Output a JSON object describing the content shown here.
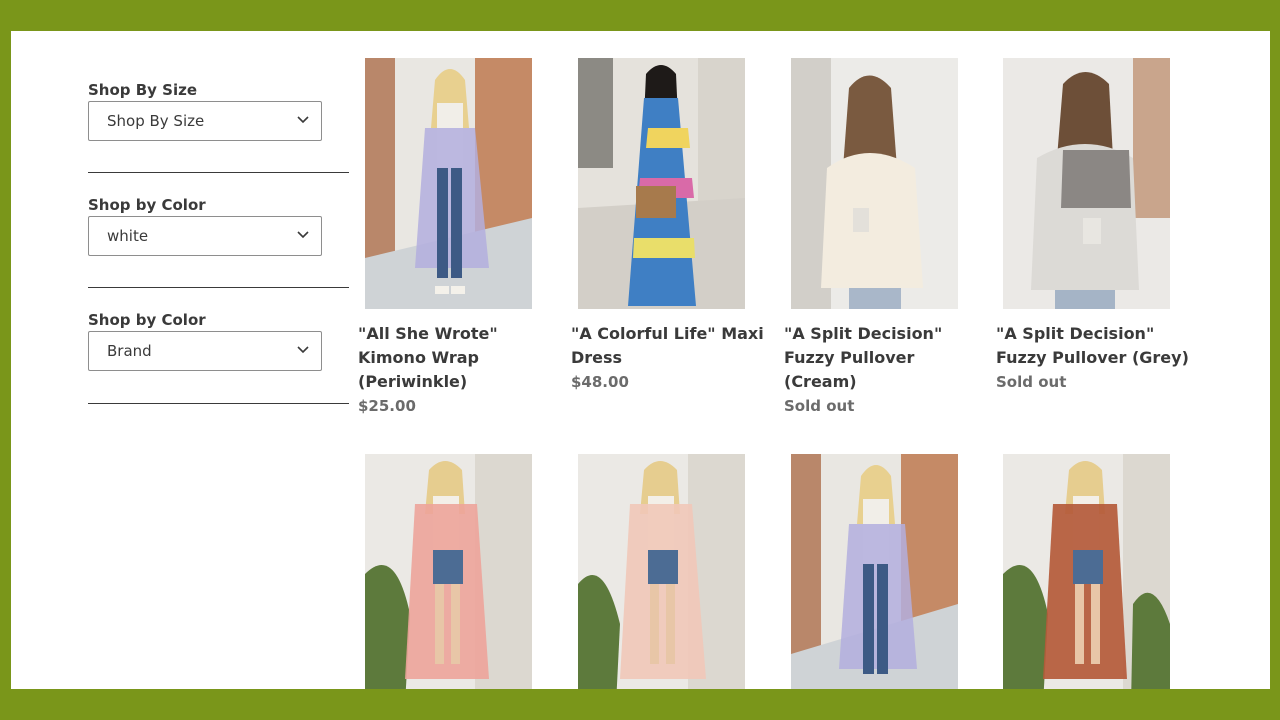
{
  "filters": [
    {
      "label": "Shop By Size",
      "value": "Shop By Size"
    },
    {
      "label": "Shop by Color",
      "value": "white"
    },
    {
      "label": "Shop by Color",
      "value": "Brand"
    }
  ],
  "products": [
    {
      "title": "\"All She Wrote\" Kimono Wrap (Periwinkle)",
      "price": "$25.00",
      "image": "woman-periwinkle-kimono-photo"
    },
    {
      "title": "\"A Colorful Life\" Maxi Dress",
      "price": "$48.00",
      "image": "woman-striped-maxi-dress-photo"
    },
    {
      "title": "\"A Split Decision\" Fuzzy Pullover (Cream)",
      "price": "Sold out",
      "image": "woman-cream-pullover-photo"
    },
    {
      "title": "\"A Split Decision\" Fuzzy Pullover (Grey)",
      "price": "Sold out",
      "image": "woman-grey-pullover-photo"
    },
    {
      "title": "",
      "price": "",
      "image": "woman-pink-kimono-photo"
    },
    {
      "title": "",
      "price": "",
      "image": "woman-blush-kimono-photo"
    },
    {
      "title": "",
      "price": "",
      "image": "woman-lavender-kimono-photo"
    },
    {
      "title": "",
      "price": "",
      "image": "woman-rust-kimono-photo"
    }
  ],
  "colors": {
    "frame": "#7a961a",
    "text": "#3a3a3a",
    "muted": "#6b6b6b"
  }
}
